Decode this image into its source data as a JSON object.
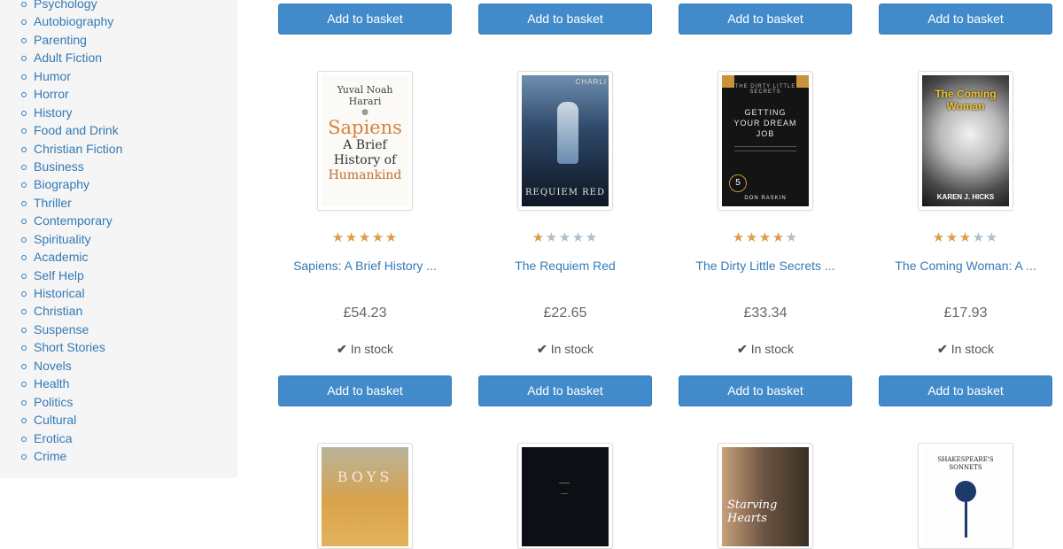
{
  "sidebar": {
    "categories": [
      "Psychology",
      "Autobiography",
      "Parenting",
      "Adult Fiction",
      "Humor",
      "Horror",
      "History",
      "Food and Drink",
      "Christian Fiction",
      "Business",
      "Biography",
      "Thriller",
      "Contemporary",
      "Spirituality",
      "Academic",
      "Self Help",
      "Historical",
      "Christian",
      "Suspense",
      "Short Stories",
      "Novels",
      "Health",
      "Politics",
      "Cultural",
      "Erotica",
      "Crime"
    ]
  },
  "button_label": "Add to basket",
  "stock_label": "In stock",
  "star_color_on": "#e09c4b",
  "star_color_off": "#b0bec9",
  "books": [
    {
      "title": "Sapiens: A Brief History ...",
      "price": "£54.23",
      "rating": 5,
      "cover": {
        "author": "Yuval Noah Harari",
        "heading": "Sapiens",
        "line1": "A Brief",
        "line2": "History of",
        "line3": "Humankind"
      }
    },
    {
      "title": "The Requiem Red",
      "price": "£22.65",
      "rating": 1,
      "cover": {
        "heading": "REQUIEM RED",
        "author": "CHARLI"
      }
    },
    {
      "title": "The Dirty Little Secrets ...",
      "price": "£33.34",
      "rating": 4,
      "cover": {
        "top": "THE DIRTY LITTLE SECRETS",
        "heading": "GETTING YOUR DREAM JOB",
        "author": "DON RASKIN"
      }
    },
    {
      "title": "The Coming Woman: A ...",
      "price": "£17.93",
      "rating": 3,
      "cover": {
        "heading": "The Coming Woman",
        "author": "KAREN J. HICKS"
      }
    }
  ],
  "next_row_covers": [
    {
      "text": "BOYS"
    },
    {
      "text": ""
    },
    {
      "text": "Starving Hearts"
    },
    {
      "top": "SHAKESPEARE'S",
      "heading": "SONNETS"
    }
  ]
}
